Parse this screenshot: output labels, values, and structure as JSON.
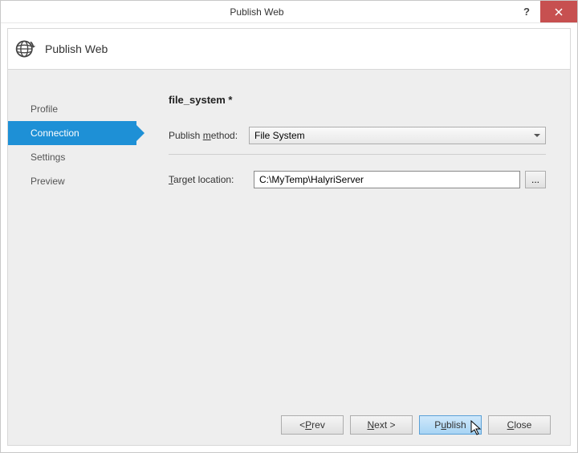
{
  "window": {
    "title": "Publish Web"
  },
  "header": {
    "title": "Publish Web"
  },
  "sidebar": {
    "items": [
      {
        "label": "Profile"
      },
      {
        "label": "Connection"
      },
      {
        "label": "Settings"
      },
      {
        "label": "Preview"
      }
    ],
    "active_index": 1
  },
  "content": {
    "profile_name": "file_system *",
    "publish_method": {
      "label_pre": "Publish ",
      "label_mn": "m",
      "label_post": "ethod:",
      "value": "File System"
    },
    "target_location": {
      "label_mn": "T",
      "label_post": "arget location:",
      "value": "C:\\MyTemp\\HalyriServer",
      "browse": "..."
    }
  },
  "footer": {
    "prev_pre": "< ",
    "prev_mn": "P",
    "prev_post": "rev",
    "next_mn": "N",
    "next_post": "ext >",
    "publish_pre": "P",
    "publish_mn": "u",
    "publish_post": "blish",
    "close_mn": "C",
    "close_post": "lose"
  }
}
